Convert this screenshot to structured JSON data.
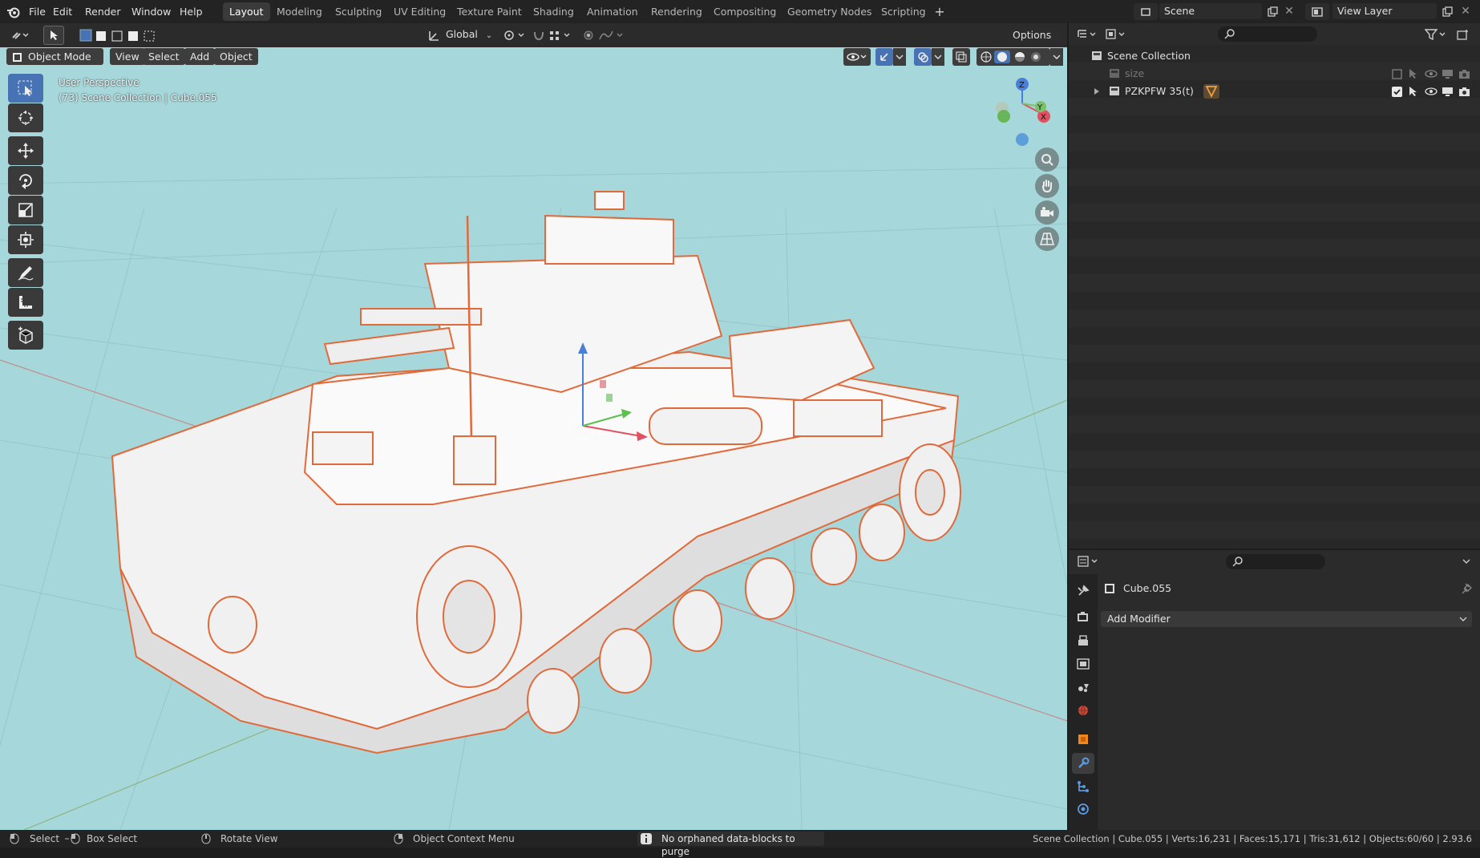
{
  "menubar": {
    "items": [
      "File",
      "Edit",
      "Render",
      "Window",
      "Help"
    ],
    "workspaces": [
      "Layout",
      "Modeling",
      "Sculpting",
      "UV Editing",
      "Texture Paint",
      "Shading",
      "Animation",
      "Rendering",
      "Compositing",
      "Geometry Nodes",
      "Scripting"
    ],
    "active_workspace": "Layout",
    "scene": "Scene",
    "view_layer": "View Layer"
  },
  "tool_header": {
    "orientation": "Global",
    "options_label": "Options"
  },
  "viewport_header": {
    "mode": "Object Mode",
    "view": "View",
    "select": "Select",
    "add": "Add",
    "object": "Object"
  },
  "viewport": {
    "perspective_label": "User Perspective",
    "collection_label": "(73) Scene Collection | Cube.055",
    "background_color": "#a6d7da",
    "selection_outline_color": "#e06a3a",
    "gizmo": {
      "x": "X",
      "y": "Y",
      "z": "Z"
    }
  },
  "toolbar": {
    "tools": [
      "select-box-icon",
      "cursor-icon",
      "move-icon",
      "rotate-icon",
      "scale-icon",
      "transform-icon",
      "annotate-icon",
      "measure-icon",
      "add-cube-icon"
    ]
  },
  "outliner": {
    "root": "Scene Collection",
    "items": [
      {
        "name": "size"
      },
      {
        "name": "PZKPFW 35(t)"
      }
    ]
  },
  "properties": {
    "object_name": "Cube.055",
    "add_modifier": "Add Modifier",
    "tabs": [
      "tool-icon",
      "render-icon",
      "output-icon",
      "view-layer-icon",
      "scene-icon",
      "world-icon",
      "object-icon",
      "modifier-icon",
      "particles-icon",
      "physics-icon"
    ]
  },
  "statusbar": {
    "select": "Select",
    "box_select": "Box Select",
    "rotate_view": "Rotate View",
    "context_menu": "Object Context Menu",
    "message": "No orphaned data-blocks to purge",
    "stats": "Scene Collection | Cube.055 | Verts:16,231 | Faces:15,171 | Tris:31,612 | Objects:60/60 | 2.93.6"
  }
}
